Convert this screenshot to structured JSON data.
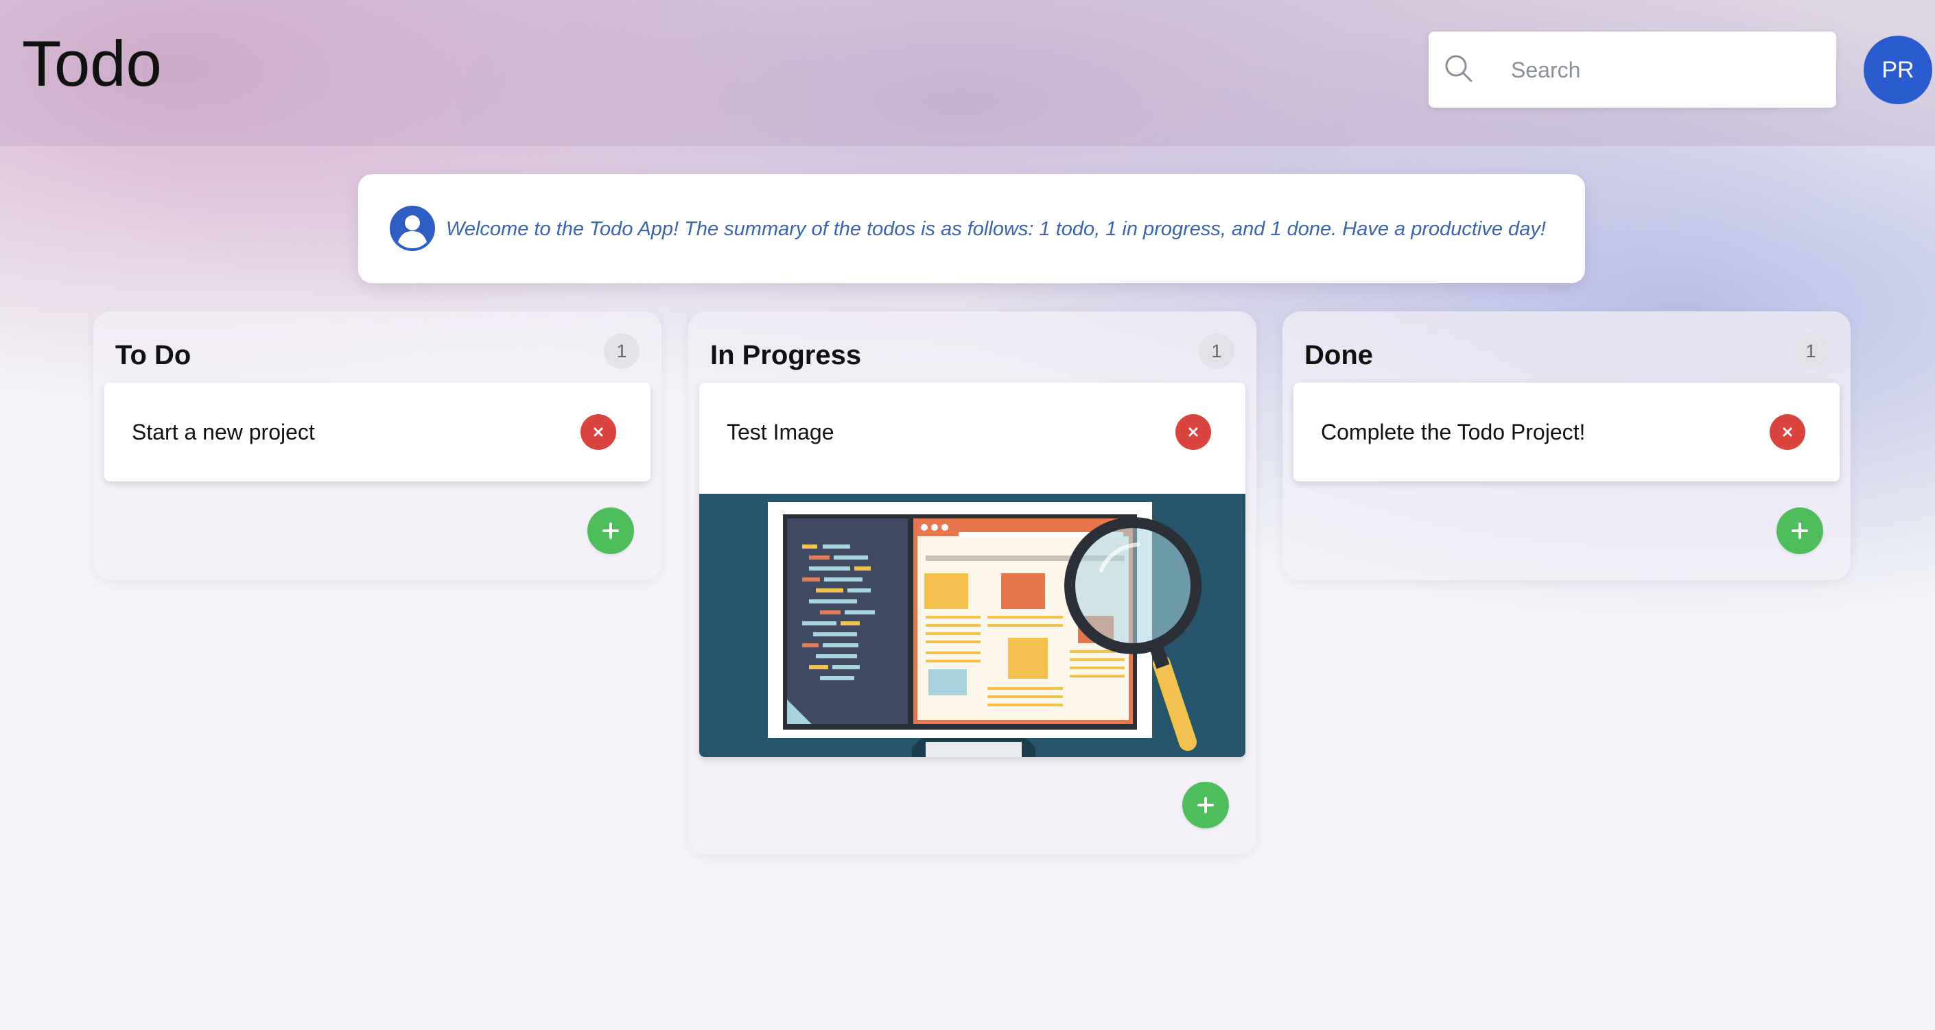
{
  "header": {
    "title": "Todo",
    "search": {
      "placeholder": "Search",
      "value": "",
      "icon": "search-icon"
    },
    "avatar": {
      "initials": "PR",
      "color": "#2a5ccf"
    }
  },
  "banner": {
    "icon": "user-circle-icon",
    "message": "Welcome to the Todo App! The summary of the todos is as follows: 1 todo, 1 in progress, and 1 done. Have a productive day!"
  },
  "columns": [
    {
      "title": "To Do",
      "count": "1",
      "cards": [
        {
          "text": "Start a new project",
          "has_image": false
        }
      ]
    },
    {
      "title": "In Progress",
      "count": "1",
      "cards": [
        {
          "text": "Test Image",
          "has_image": true,
          "image": "monitor-code-magnifier-illustration"
        }
      ]
    },
    {
      "title": "Done",
      "count": "1",
      "cards": [
        {
          "text": "Complete the Todo Project!",
          "has_image": false
        }
      ]
    }
  ],
  "colors": {
    "delete": "#d9443f",
    "add": "#4ebd5b",
    "accent": "#2a5ccf",
    "banner_text": "#3a64ad"
  },
  "icons": {
    "delete": "close-icon",
    "add": "plus-icon"
  }
}
